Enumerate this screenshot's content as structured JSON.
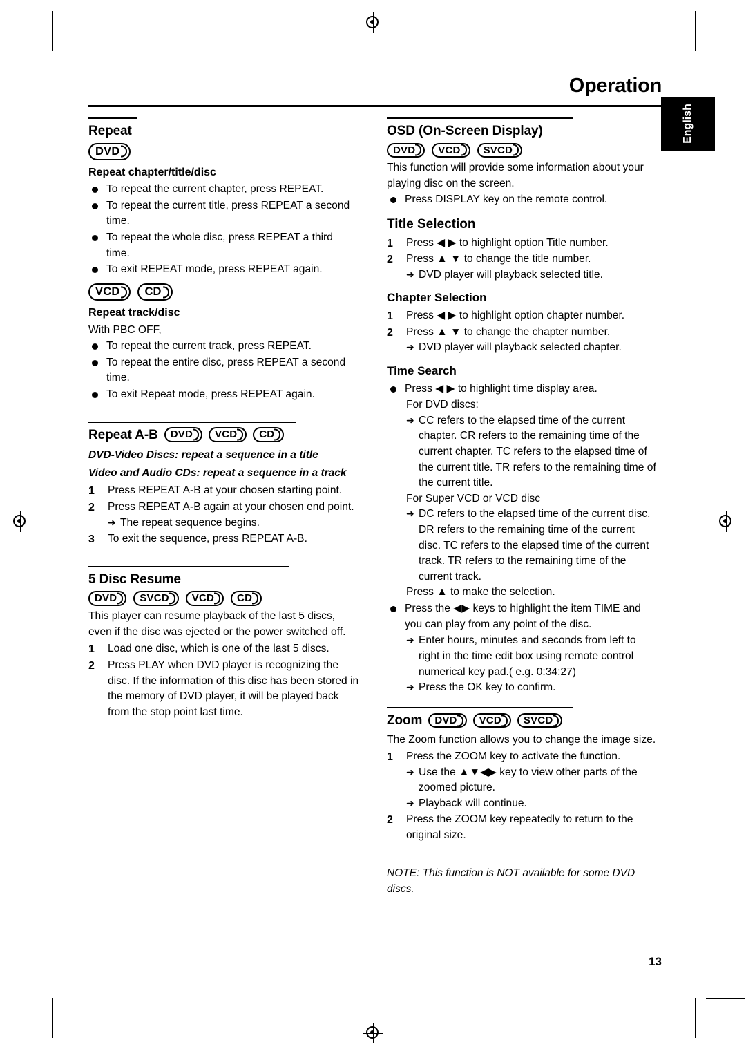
{
  "header": {
    "title": "Operation",
    "language_tab": "English",
    "page_number": "13"
  },
  "left_column": {
    "repeat": {
      "heading": "Repeat",
      "logos": [
        "DVD"
      ],
      "sub1": {
        "heading": "Repeat chapter/title/disc",
        "bullets": [
          "To repeat the current chapter, press REPEAT.",
          "To repeat the current title, press REPEAT a second time.",
          "To repeat the whole disc, press REPEAT a third time.",
          "To exit REPEAT mode, press REPEAT again."
        ]
      },
      "sub2": {
        "logos": [
          "VCD",
          "CD"
        ],
        "heading": "Repeat track/disc",
        "intro": "With PBC OFF,",
        "bullets": [
          "To repeat the current track, press REPEAT.",
          "To repeat the entire disc, press REPEAT a second time.",
          "To exit Repeat mode, press REPEAT again."
        ]
      }
    },
    "repeat_ab": {
      "heading": "Repeat A-B",
      "logos": [
        "DVD",
        "VCD",
        "CD"
      ],
      "subitalic1": "DVD-Video Discs: repeat a sequence in a title",
      "subitalic2": "Video and Audio CDs: repeat a sequence in a track",
      "steps": [
        {
          "num": "1",
          "text": "Press REPEAT A-B at your chosen starting point."
        },
        {
          "num": "2",
          "text": "Press REPEAT A-B again at your chosen end point.",
          "arrow": "The repeat sequence begins."
        },
        {
          "num": "3",
          "text": "To exit the sequence, press REPEAT A-B."
        }
      ]
    },
    "disc_resume": {
      "heading": "5 Disc Resume",
      "logos": [
        "DVD",
        "SVCD",
        "VCD",
        "CD"
      ],
      "intro": "This player can resume playback of the last 5 discs, even if the disc was ejected or the power switched off.",
      "steps": [
        {
          "num": "1",
          "text": "Load one disc, which is one of the last 5 discs."
        },
        {
          "num": "2",
          "text": "Press PLAY when DVD player is recognizing the disc. If the information of this disc has been stored in the memory of DVD player,  it will be played back from the stop point last time."
        }
      ]
    }
  },
  "right_column": {
    "osd": {
      "heading": "OSD (On-Screen Display)",
      "logos": [
        "DVD",
        "VCD",
        "SVCD"
      ],
      "intro": "This function will provide some information about your playing disc on the screen.",
      "bullets": [
        "Press DISPLAY key on the remote control."
      ]
    },
    "title_selection": {
      "heading": "Title Selection",
      "steps": [
        {
          "num": "1",
          "text": "Press ◀ ▶ to highlight option Title number."
        },
        {
          "num": "2",
          "text": "Press ▲ ▼ to change the title number.",
          "arrow": "DVD player will playback selected title."
        }
      ]
    },
    "chapter_selection": {
      "heading": "Chapter Selection",
      "steps": [
        {
          "num": "1",
          "text": "Press ◀ ▶ to highlight option chapter number."
        },
        {
          "num": "2",
          "text": "Press ▲ ▼ to change the chapter number.",
          "arrow": "DVD player will playback selected chapter."
        }
      ]
    },
    "time_search": {
      "heading": "Time Search",
      "bullet1": "Press ◀ ▶ to highlight time display area.",
      "line_dvd": "For DVD discs:",
      "arrow_dvd": "CC refers to the elapsed time of the current chapter. CR refers to the remaining time of the current chapter. TC refers to the elapsed time of the current title. TR refers to the remaining time of the current title.",
      "line_vcd": "For Super VCD or VCD disc",
      "arrow_vcd": "DC refers to the elapsed time of the current disc. DR refers to the remaining time of the current disc. TC refers to the elapsed time of the current track. TR refers to the remaining time of the current track.",
      "make_selection": "Press ▲ to make the selection.",
      "bullet2": "Press the ◀▶ keys to highlight the item TIME and you can play from any point of the disc.",
      "arrow1": "Enter hours, minutes and seconds from left to right in the time edit box using remote control numerical key pad.( e.g. 0:34:27)",
      "arrow2": "Press the OK key to confirm."
    },
    "zoom": {
      "heading": "Zoom",
      "logos": [
        "DVD",
        "VCD",
        "SVCD"
      ],
      "intro": "The Zoom function allows you to change the image size.",
      "steps": [
        {
          "num": "1",
          "text": "Press the ZOOM key to activate the function.",
          "arrow": "Use the ▲▼◀▶ key to view other parts of the zoomed picture.",
          "arrow2": "Playback will continue."
        },
        {
          "num": "2",
          "text": "Press the ZOOM key repeatedly to return to the original size."
        }
      ],
      "note": "NOTE: This function is NOT available for some DVD discs."
    }
  }
}
